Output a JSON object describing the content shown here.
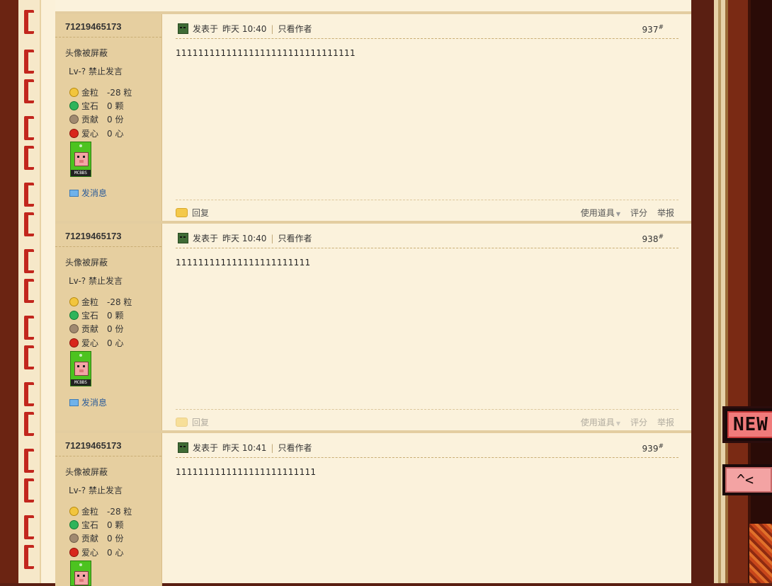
{
  "labels": {
    "avatar_hidden": "头像被屏蔽",
    "posted_at_prefix": "发表于",
    "only_author": "只看作者",
    "send_message": "发消息",
    "reply": "回复",
    "use_item": "使用道具",
    "rate": "评分",
    "report": "举报",
    "floor_suffix": "#"
  },
  "stats_labels": {
    "gold": "金粒",
    "gem": "宝石",
    "contribution": "贡献",
    "heart": "爱心"
  },
  "badge_text": "MCBBS",
  "side_signs": {
    "new": "NEW",
    "pig": "^<"
  },
  "posts": [
    {
      "author": "71219465173",
      "level": "Lv-? 禁止发言",
      "gold": "-28 粒",
      "gem": "0 颗",
      "contribution": "0 份",
      "heart": "0 心",
      "time": "昨天 10:40",
      "floor": "937",
      "body": "11111111111111111111111111111111"
    },
    {
      "author": "71219465173",
      "level": "Lv-? 禁止发言",
      "gold": "-28 粒",
      "gem": "0 颗",
      "contribution": "0 份",
      "heart": "0 心",
      "time": "昨天 10:40",
      "floor": "938",
      "body": "111111111111111111111111"
    },
    {
      "author": "71219465173",
      "level": "Lv-? 禁止发言",
      "gold": "-28 粒",
      "gem": "0 颗",
      "contribution": "0 份",
      "heart": "0 心",
      "time": "昨天 10:41",
      "floor": "939",
      "body": "1111111111111111111111111"
    }
  ],
  "colors": {
    "author_column": "#e6cfa0",
    "content_background": "#fbf2dc",
    "border_accent": "#e3cda0",
    "link_blue": "#2b5b99"
  }
}
